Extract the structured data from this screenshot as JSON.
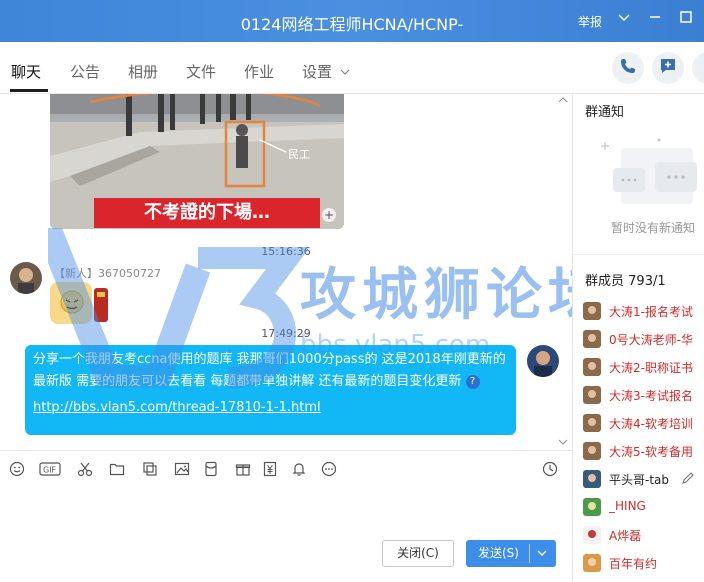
{
  "window": {
    "title": "0124网络工程师HCNA/HCNP-",
    "report_label": "举报"
  },
  "tabs": [
    {
      "label": "聊天",
      "active": true
    },
    {
      "label": "公告"
    },
    {
      "label": "相册"
    },
    {
      "label": "文件"
    },
    {
      "label": "作业"
    },
    {
      "label": "设置"
    }
  ],
  "chat": {
    "image_caption": "不考證的下場…",
    "image_label": "民工",
    "time1": "15:16:36",
    "sender": "【新人】367050727",
    "time2": "17:49:29",
    "message_text": "分享一个我朋友考ccna使用的题库 我那哥们1000分pass的 这是2018年刚更新的最新版 需要的朋友可以去看看 每题都带单独讲解 还有最新的题目变化更新",
    "message_link": "http://bbs.vlan5.com/thread-17810-1-1.html"
  },
  "watermark": {
    "text": "攻城狮论坛",
    "sub": "bbs.vlan5.com"
  },
  "buttons": {
    "close": "关闭(C)",
    "send": "发送(S)"
  },
  "right_panel": {
    "notice_title": "群通知",
    "notice_empty": "暂时没有新通知",
    "members_label": "群成员",
    "members_count": "793/1",
    "members": [
      {
        "name": "大涛1-报名考试",
        "color": "#d12b2b"
      },
      {
        "name": "0号大涛老师-华",
        "color": "#d12b2b"
      },
      {
        "name": "大涛2-职称证书",
        "color": "#d12b2b"
      },
      {
        "name": "大涛3-考试报名",
        "color": "#d12b2b"
      },
      {
        "name": "大涛4-软考培训",
        "color": "#d12b2b"
      },
      {
        "name": "大涛5-软考备用",
        "color": "#d12b2b"
      },
      {
        "name": "平头哥-tab",
        "color": "#222222"
      },
      {
        "name": "_HING",
        "color": "#d12b2b"
      },
      {
        "name": "A烨磊",
        "color": "#d12b2b"
      },
      {
        "name": "百年有约",
        "color": "#d12b2b"
      }
    ]
  },
  "colors": {
    "titlebar": "#4a8fe0",
    "bubble": "#12b7f5",
    "send_button": "#3c8ee8",
    "member_admin": "#d12b2b"
  }
}
